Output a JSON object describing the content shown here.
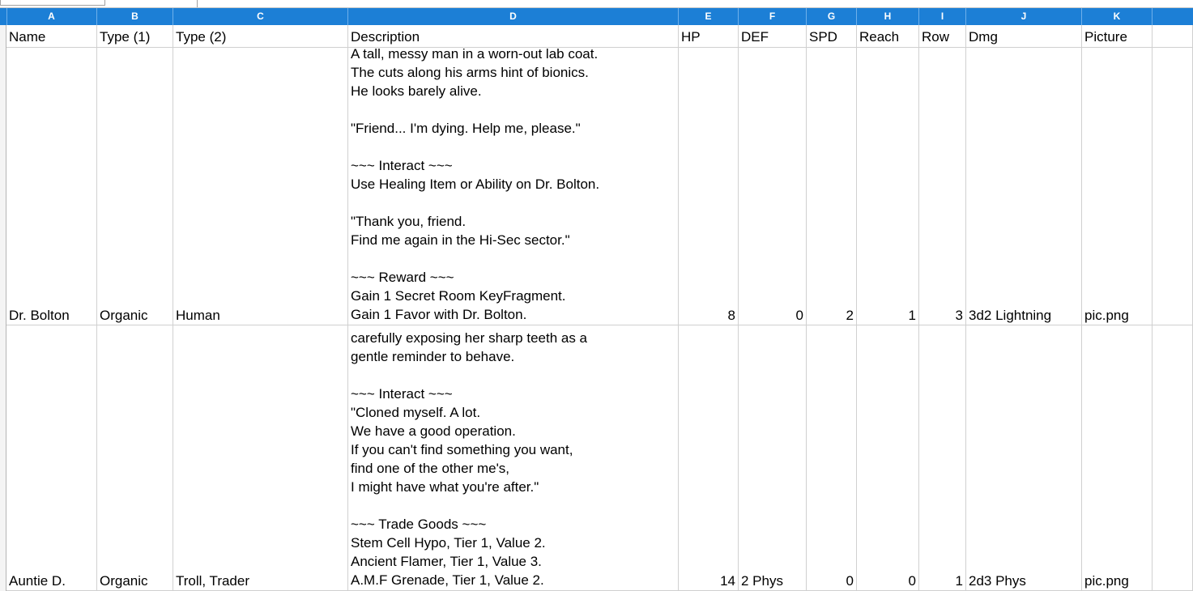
{
  "columns": [
    "A",
    "B",
    "C",
    "D",
    "E",
    "F",
    "G",
    "H",
    "I",
    "J",
    "K"
  ],
  "headers": [
    "Name",
    "Type (1)",
    "Type (2)",
    "Description",
    "HP",
    "DEF",
    "SPD",
    "Reach",
    "Row",
    "Dmg",
    "Picture"
  ],
  "rows": [
    {
      "name": "Dr. Bolton",
      "type1": "Organic",
      "type2": "Human",
      "description": "A tall, messy man in a worn-out lab coat.\nThe cuts along his arms hint of bionics.\nHe looks barely alive.\n\n\"Friend... I'm dying. Help me, please.\"\n\n~~~ Interact ~~~\nUse Healing Item or Ability on Dr. Bolton.\n\n\"Thank you, friend.\nFind me again in the Hi-Sec sector.\"\n\n~~~ Reward ~~~\nGain 1 Secret Room KeyFragment.\nGain 1 Favor with Dr. Bolton.",
      "hp": "8",
      "def": "0",
      "spd": "2",
      "reach": "1",
      "row": "3",
      "dmg": "3d2 Lightning",
      "picture": "pic.png"
    },
    {
      "name": "Auntie D.",
      "type1": "Organic",
      "type2": "Troll, Trader",
      "description": "carefully exposing her sharp teeth as a\ngentle reminder to behave.\n\n~~~ Interact ~~~\n\"Cloned myself. A lot.\nWe have a good operation.\nIf you can't find something you want,\nfind one of the other me's,\nI might have what you're after.\"\n\n~~~ Trade Goods ~~~\nStem Cell Hypo, Tier 1, Value 2.\nAncient Flamer, Tier 1, Value 3.\nA.M.F Grenade, Tier 1, Value 2.",
      "hp": "14",
      "def": "2 Phys",
      "spd": "0",
      "reach": "0",
      "row": "1",
      "dmg": "2d3 Phys",
      "picture": "pic.png"
    }
  ]
}
